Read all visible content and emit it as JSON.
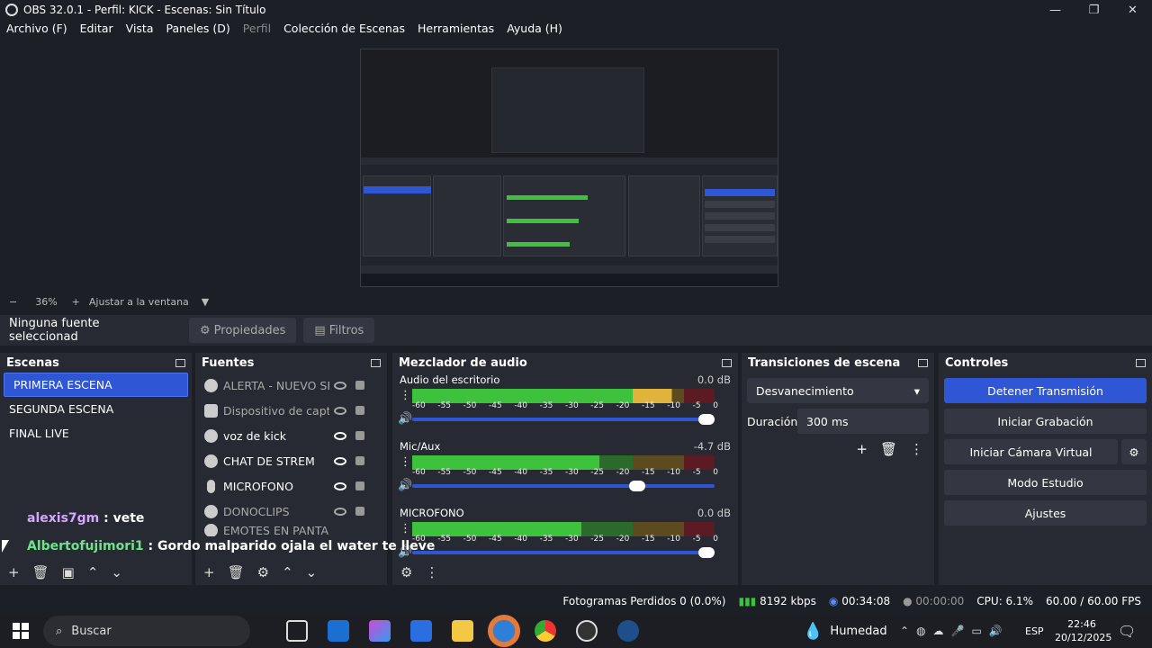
{
  "window": {
    "title": "OBS 32.0.1 - Perfil: KICK - Escenas: Sin Título",
    "min": "—",
    "restore": "❐",
    "close": "✕"
  },
  "menu": [
    {
      "label": "Archivo (F)",
      "dim": false
    },
    {
      "label": "Editar",
      "dim": false
    },
    {
      "label": "Vista",
      "dim": false
    },
    {
      "label": "Paneles (D)",
      "dim": false
    },
    {
      "label": "Perfil",
      "dim": true
    },
    {
      "label": "Colección de Escenas",
      "dim": false
    },
    {
      "label": "Herramientas",
      "dim": false
    },
    {
      "label": "Ayuda (H)",
      "dim": false
    }
  ],
  "zoom": {
    "minus": "−",
    "value": "36%",
    "plus": "+",
    "fit": "Ajustar a la ventana",
    "caret": "▼"
  },
  "source_bar": {
    "selected": "Ninguna fuente seleccionad",
    "properties": "Propiedades",
    "filters": "Filtros"
  },
  "scenes": {
    "title": "Escenas",
    "items": [
      "PRIMERA ESCENA",
      "SEGUNDA ESCENA",
      "FINAL LIVE"
    ]
  },
  "sources": {
    "title": "Fuentes",
    "items": [
      {
        "name": "ALERTA - NUEVO SEG",
        "visible": false
      },
      {
        "name": "Dispositivo de captur",
        "visible": false
      },
      {
        "name": "voz de kick",
        "visible": true
      },
      {
        "name": "CHAT DE STREM",
        "visible": true
      },
      {
        "name": "MICROFONO",
        "visible": true
      },
      {
        "name": "DONOCLIPS",
        "visible": true
      },
      {
        "name": "EMOTES EN PANTALL",
        "visible": true
      }
    ]
  },
  "mixer": {
    "title": "Mezclador de audio",
    "ticks": [
      "-60",
      "-55",
      "-50",
      "-45",
      "-40",
      "-35",
      "-30",
      "-25",
      "-20",
      "-15",
      "-10",
      "-5",
      "0"
    ],
    "channels": [
      {
        "name": "Audio del escritorio",
        "db": "0.0 dB",
        "level": 0.86,
        "volume": 1.0
      },
      {
        "name": "Mic/Aux",
        "db": "-4.7 dB",
        "level": 0.62,
        "volume": 0.77
      },
      {
        "name": "MICROFONO",
        "db": "0.0 dB",
        "level": 0.56,
        "volume": 1.0
      }
    ]
  },
  "transitions": {
    "title": "Transiciones de escena",
    "selected": "Desvanecimiento",
    "duration_label": "Duración",
    "duration_value": "300 ms"
  },
  "controls": {
    "title": "Controles",
    "buttons": [
      "Detener Transmisión",
      "Iniciar Grabación",
      "Iniciar Cámara Virtual",
      "Modo Estudio",
      "Ajustes"
    ]
  },
  "chat": [
    {
      "user": "alexis7gm",
      "msg": ": vete",
      "color": "#d7a6ff"
    },
    {
      "user": "Albertofujimori1",
      "msg": ": Gordo malparido ojala el water te lleve",
      "color": "#6fe38b"
    }
  ],
  "status": {
    "dropped": "Fotogramas Perdidos 0 (0.0%)",
    "bitrate": "8192 kbps",
    "stream_time": "00:34:08",
    "rec_time": "00:00:00",
    "cpu": "CPU: 6.1%",
    "fps": "60.00 / 60.00 FPS"
  },
  "taskbar": {
    "search": "Buscar",
    "weather": "Humedad",
    "lang": "ESP",
    "time": "22:46",
    "date": "20/12/2025"
  }
}
